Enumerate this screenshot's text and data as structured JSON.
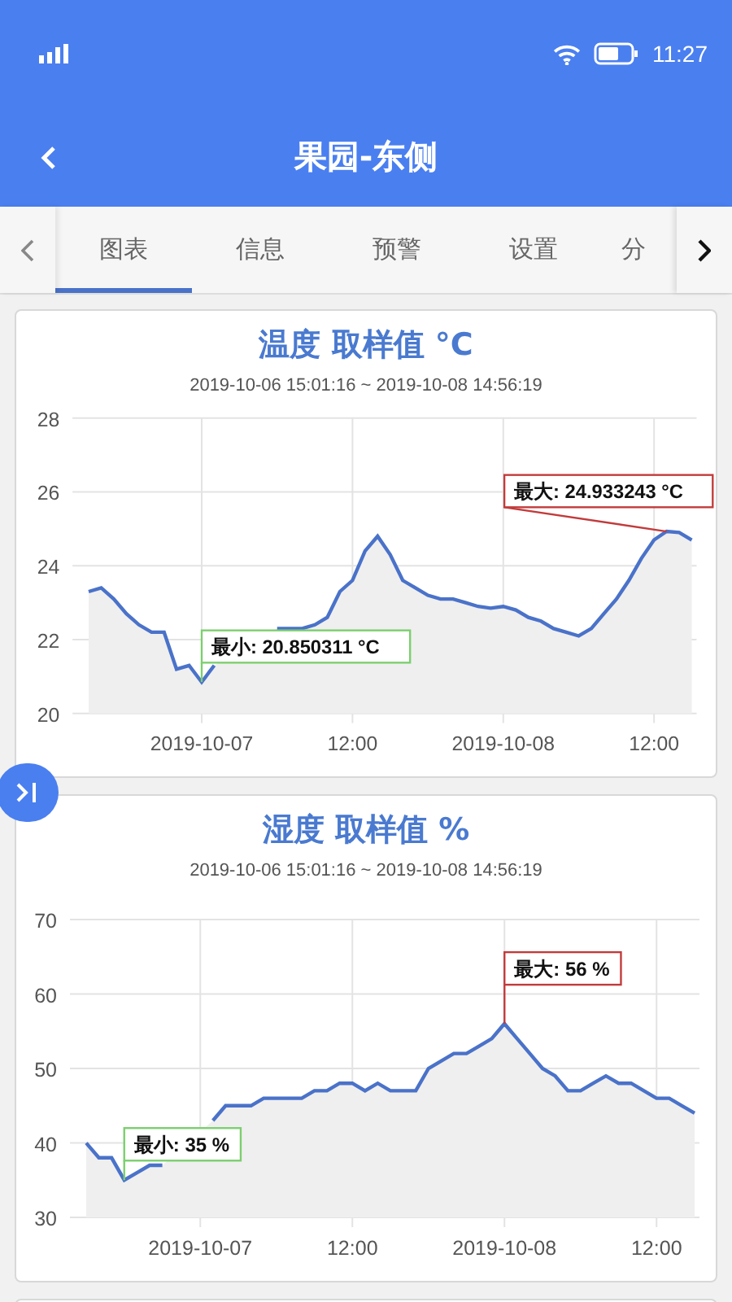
{
  "status_bar": {
    "time": "11:27"
  },
  "header": {
    "title": "果园-东侧"
  },
  "tabs": [
    {
      "label": "图表",
      "selected": true
    },
    {
      "label": "信息",
      "selected": false
    },
    {
      "label": "预警",
      "selected": false
    },
    {
      "label": "设置",
      "selected": false
    },
    {
      "label": "分",
      "selected": false
    }
  ],
  "charts": [
    {
      "subtitle": "2019-10-06 15:01:16 ~ 2019-10-08 14:56:19",
      "chart_data": {
        "type": "area",
        "title": "温度 取样值 °C",
        "grid": true,
        "categories": [
          null,
          null,
          null,
          null,
          null,
          null,
          null,
          null,
          null,
          "2019-10-07",
          null,
          null,
          null,
          null,
          null,
          null,
          null,
          null,
          null,
          null,
          null,
          "12:00",
          null,
          null,
          null,
          null,
          null,
          null,
          null,
          null,
          null,
          null,
          null,
          "2019-10-08",
          null,
          null,
          null,
          null,
          null,
          null,
          null,
          null,
          null,
          null,
          null,
          "12:00",
          null,
          null,
          null
        ],
        "series": [
          {
            "color": "#4a72c9",
            "values": [
              23.3,
              23.4,
              23.1,
              22.7,
              22.4,
              22.2,
              22.2,
              21.2,
              21.3,
              20.85,
              21.3,
              null,
              null,
              null,
              null,
              22.3,
              22.3,
              22.3,
              22.4,
              22.6,
              23.3,
              23.6,
              24.4,
              24.8,
              24.3,
              23.6,
              23.4,
              23.2,
              23.1,
              23.1,
              23.0,
              22.9,
              22.85,
              22.9,
              22.8,
              22.6,
              22.5,
              22.3,
              22.2,
              22.1,
              22.3,
              22.7,
              23.1,
              23.6,
              24.2,
              24.7,
              24.93,
              24.9,
              24.7
            ]
          }
        ],
        "ylim": [
          20,
          28
        ],
        "yticks": [
          20,
          22,
          24,
          26,
          28
        ],
        "annotations": [
          "最小: 20.850311 °C",
          "最大: 24.933243 °C"
        ]
      }
    },
    {
      "subtitle": "2019-10-06 15:01:16 ~ 2019-10-08 14:56:19",
      "chart_data": {
        "type": "area",
        "title": "湿度 取样值 %",
        "grid": true,
        "categories": [
          null,
          null,
          null,
          null,
          null,
          null,
          null,
          null,
          null,
          "2019-10-07",
          null,
          null,
          null,
          null,
          null,
          null,
          null,
          null,
          null,
          null,
          null,
          "12:00",
          null,
          null,
          null,
          null,
          null,
          null,
          null,
          null,
          null,
          null,
          null,
          "2019-10-08",
          null,
          null,
          null,
          null,
          null,
          null,
          null,
          null,
          null,
          null,
          null,
          "12:00",
          null,
          null,
          null
        ],
        "series": [
          {
            "color": "#4a72c9",
            "values": [
              40,
              38,
              38,
              35,
              36,
              37,
              37,
              null,
              null,
              null,
              43,
              45,
              45,
              45,
              46,
              46,
              46,
              46,
              47,
              47,
              48,
              48,
              47,
              48,
              47,
              47,
              47,
              50,
              51,
              52,
              52,
              53,
              54,
              56,
              54,
              52,
              50,
              49,
              47,
              47,
              48,
              49,
              48,
              48,
              47,
              46,
              46,
              45,
              44
            ]
          }
        ],
        "ylim": [
          30,
          70
        ],
        "yticks": [
          30,
          40,
          50,
          60,
          70
        ],
        "annotations": [
          "最小: 35 %",
          "最大: 56 %"
        ]
      }
    }
  ]
}
